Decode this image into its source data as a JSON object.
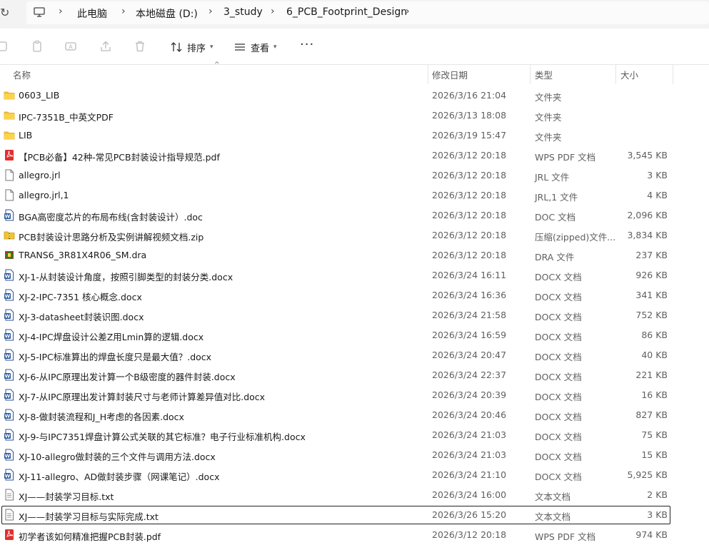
{
  "breadcrumb": [
    "此电脑",
    "本地磁盘 (D:)",
    "3_study",
    "6_PCB_Footprint_Design"
  ],
  "toolbar": {
    "sort_label": "排序",
    "view_label": "查看",
    "more_label": "···"
  },
  "columns": {
    "name": "名称",
    "date": "修改日期",
    "type": "类型",
    "size": "大小"
  },
  "files": [
    {
      "name": "0603_LIB",
      "date": "2026/3/16 21:04",
      "type": "文件夹",
      "size": "",
      "icon": "folder-icon"
    },
    {
      "name": "IPC-7351B_中英文PDF",
      "date": "2026/3/13 18:08",
      "type": "文件夹",
      "size": "",
      "icon": "folder-icon"
    },
    {
      "name": "LIB",
      "date": "2026/3/19 15:47",
      "type": "文件夹",
      "size": "",
      "icon": "folder-icon"
    },
    {
      "name": "【PCB必备】42种-常见PCB封装设计指导规范.pdf",
      "date": "2026/3/12 20:18",
      "type": "WPS PDF 文档",
      "size": "3,545 KB",
      "icon": "pdf-icon"
    },
    {
      "name": "allegro.jrl",
      "date": "2026/3/12 20:18",
      "type": "JRL 文件",
      "size": "3 KB",
      "icon": "file-icon"
    },
    {
      "name": "allegro.jrl,1",
      "date": "2026/3/12 20:18",
      "type": "JRL,1 文件",
      "size": "4 KB",
      "icon": "file-icon"
    },
    {
      "name": "BGA高密度芯片的布局布线(含封装设计）.doc",
      "date": "2026/3/12 20:18",
      "type": "DOC 文档",
      "size": "2,096 KB",
      "icon": "word-icon"
    },
    {
      "name": "PCB封装设计思路分析及实例讲解视频文档.zip",
      "date": "2026/3/12 20:18",
      "type": "压缩(zipped)文件...",
      "size": "3,834 KB",
      "icon": "zip-icon"
    },
    {
      "name": "TRANS6_3R81X4R06_SM.dra",
      "date": "2026/3/12 20:18",
      "type": "DRA 文件",
      "size": "237 KB",
      "icon": "dra-icon"
    },
    {
      "name": "XJ-1-从封装设计角度，按照引脚类型的封装分类.docx",
      "date": "2026/3/24 16:11",
      "type": "DOCX 文档",
      "size": "926 KB",
      "icon": "word-icon"
    },
    {
      "name": "XJ-2-IPC-7351 核心概念.docx",
      "date": "2026/3/24 16:36",
      "type": "DOCX 文档",
      "size": "341 KB",
      "icon": "word-icon"
    },
    {
      "name": "XJ-3-datasheet封装识图.docx",
      "date": "2026/3/24 21:58",
      "type": "DOCX 文档",
      "size": "752 KB",
      "icon": "word-icon"
    },
    {
      "name": "XJ-4-IPC焊盘设计公差Z用Lmin算的逻辑.docx",
      "date": "2026/3/24 16:59",
      "type": "DOCX 文档",
      "size": "86 KB",
      "icon": "word-icon"
    },
    {
      "name": "XJ-5-IPC标准算出的焊盘长度只是最大值？.docx",
      "date": "2026/3/24 20:47",
      "type": "DOCX 文档",
      "size": "40 KB",
      "icon": "word-icon"
    },
    {
      "name": "XJ-6-从IPC原理出发计算一个B级密度的器件封装.docx",
      "date": "2026/3/24 22:37",
      "type": "DOCX 文档",
      "size": "221 KB",
      "icon": "word-icon"
    },
    {
      "name": "XJ-7-从IPC原理出发计算封装尺寸与老师计算差异值对比.docx",
      "date": "2026/3/24 20:39",
      "type": "DOCX 文档",
      "size": "16 KB",
      "icon": "word-icon"
    },
    {
      "name": "XJ-8-做封装流程和J_H考虑的各因素.docx",
      "date": "2026/3/24 20:46",
      "type": "DOCX 文档",
      "size": "827 KB",
      "icon": "word-icon"
    },
    {
      "name": "XJ-9-与IPC7351焊盘计算公式关联的其它标准？电子行业标准机构.docx",
      "date": "2026/3/24 21:03",
      "type": "DOCX 文档",
      "size": "75 KB",
      "icon": "word-icon"
    },
    {
      "name": "XJ-10-allegro做封装的三个文件与调用方法.docx",
      "date": "2026/3/24 21:03",
      "type": "DOCX 文档",
      "size": "15 KB",
      "icon": "word-icon"
    },
    {
      "name": "XJ-11-allegro、AD做封装步骤（网课笔记）.docx",
      "date": "2026/3/24 21:10",
      "type": "DOCX 文档",
      "size": "5,925 KB",
      "icon": "word-icon"
    },
    {
      "name": "XJ——封装学习目标.txt",
      "date": "2026/3/24 16:00",
      "type": "文本文档",
      "size": "2 KB",
      "icon": "txt-icon"
    },
    {
      "name": "XJ——封装学习目标与实际完成.txt",
      "date": "2026/3/26 15:20",
      "type": "文本文档",
      "size": "3 KB",
      "icon": "txt-icon",
      "selected": true
    },
    {
      "name": "初学者该如何精准把握PCB封装.pdf",
      "date": "2026/3/12 20:18",
      "type": "WPS PDF 文档",
      "size": "974 KB",
      "icon": "pdf-icon"
    }
  ]
}
